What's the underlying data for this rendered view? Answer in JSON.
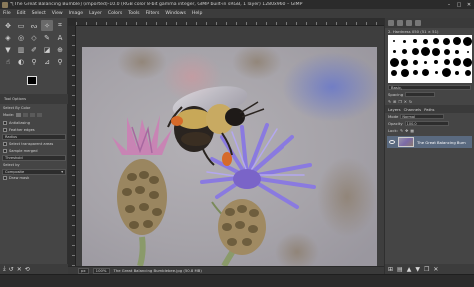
{
  "window": {
    "title": "*[The Great Balancing Bumble] (imported)-10.0 (RGB color 8-bit gamma integer, GIMP built-in sRGB, 1 layer) 1280x960 – GIMP",
    "minimize_icon": "minimize-icon",
    "maximize_icon": "maximize-icon",
    "close_icon": "close-icon"
  },
  "menu": [
    "File",
    "Edit",
    "Select",
    "View",
    "Image",
    "Layer",
    "Colors",
    "Tools",
    "Filters",
    "Windows",
    "Help"
  ],
  "toolbox": {
    "tools": [
      {
        "name": "move-tool-icon",
        "glyph": "✥"
      },
      {
        "name": "rect-select-icon",
        "glyph": "▭"
      },
      {
        "name": "free-select-icon",
        "glyph": "ᔓ"
      },
      {
        "name": "fuzzy-select-icon",
        "glyph": "✧"
      },
      {
        "name": "crop-icon",
        "glyph": "⌗"
      },
      {
        "name": "unified-transform-icon",
        "glyph": "◈"
      },
      {
        "name": "warp-icon",
        "glyph": "◎"
      },
      {
        "name": "handle-transform-icon",
        "glyph": "◇"
      },
      {
        "name": "paths-icon",
        "glyph": "✎"
      },
      {
        "name": "text-icon",
        "glyph": "A"
      },
      {
        "name": "bucket-fill-icon",
        "glyph": "▼"
      },
      {
        "name": "gradient-icon",
        "glyph": "▥"
      },
      {
        "name": "paintbrush-icon",
        "glyph": "✐"
      },
      {
        "name": "eraser-icon",
        "glyph": "◪"
      },
      {
        "name": "clone-icon",
        "glyph": "⊕"
      },
      {
        "name": "smudge-icon",
        "glyph": "☝"
      },
      {
        "name": "dodge-icon",
        "glyph": "◐"
      },
      {
        "name": "color-picker-icon",
        "glyph": "⚲"
      },
      {
        "name": "measure-icon",
        "glyph": "⊿"
      },
      {
        "name": "zoom-icon",
        "glyph": "⚲"
      }
    ],
    "active_tool_index": 3,
    "options": {
      "tabs": [
        "Tool Options"
      ],
      "title": "Select By Color",
      "mode_label": "Mode:",
      "antialiasing": "Antialiasing",
      "feather_edges": "Feather edges",
      "radius_label": "Radius",
      "select_transparent": "Select transparent areas",
      "sample_merged": "Sample merged",
      "threshold_label": "Threshold",
      "select_by_label": "Select by",
      "select_by_value": "Composite",
      "draw_mask": "Draw mask"
    }
  },
  "canvas": {
    "status_unit": "px",
    "status_zoom": "100%",
    "status_text": "The Great Balancing Bumblebee.jpg (50.8 MB)"
  },
  "dock": {
    "brushes_tab": "Brushes",
    "brush_name": "2. Hardness 050 (51 × 51)",
    "filter_label": "Basic,",
    "spacing_label": "Spacing",
    "layers_tabs": [
      "Layers",
      "Channels",
      "Paths"
    ],
    "mode_label": "Mode",
    "mode_value": "Normal",
    "opacity_label": "Opacity",
    "opacity_value": "100.0",
    "lock_label": "Lock:",
    "layer_name": "The Great Balancing Bum"
  },
  "colors": {
    "fg": "#000000",
    "bg": "#ffffff",
    "selected_layer": "#5a6a80"
  }
}
